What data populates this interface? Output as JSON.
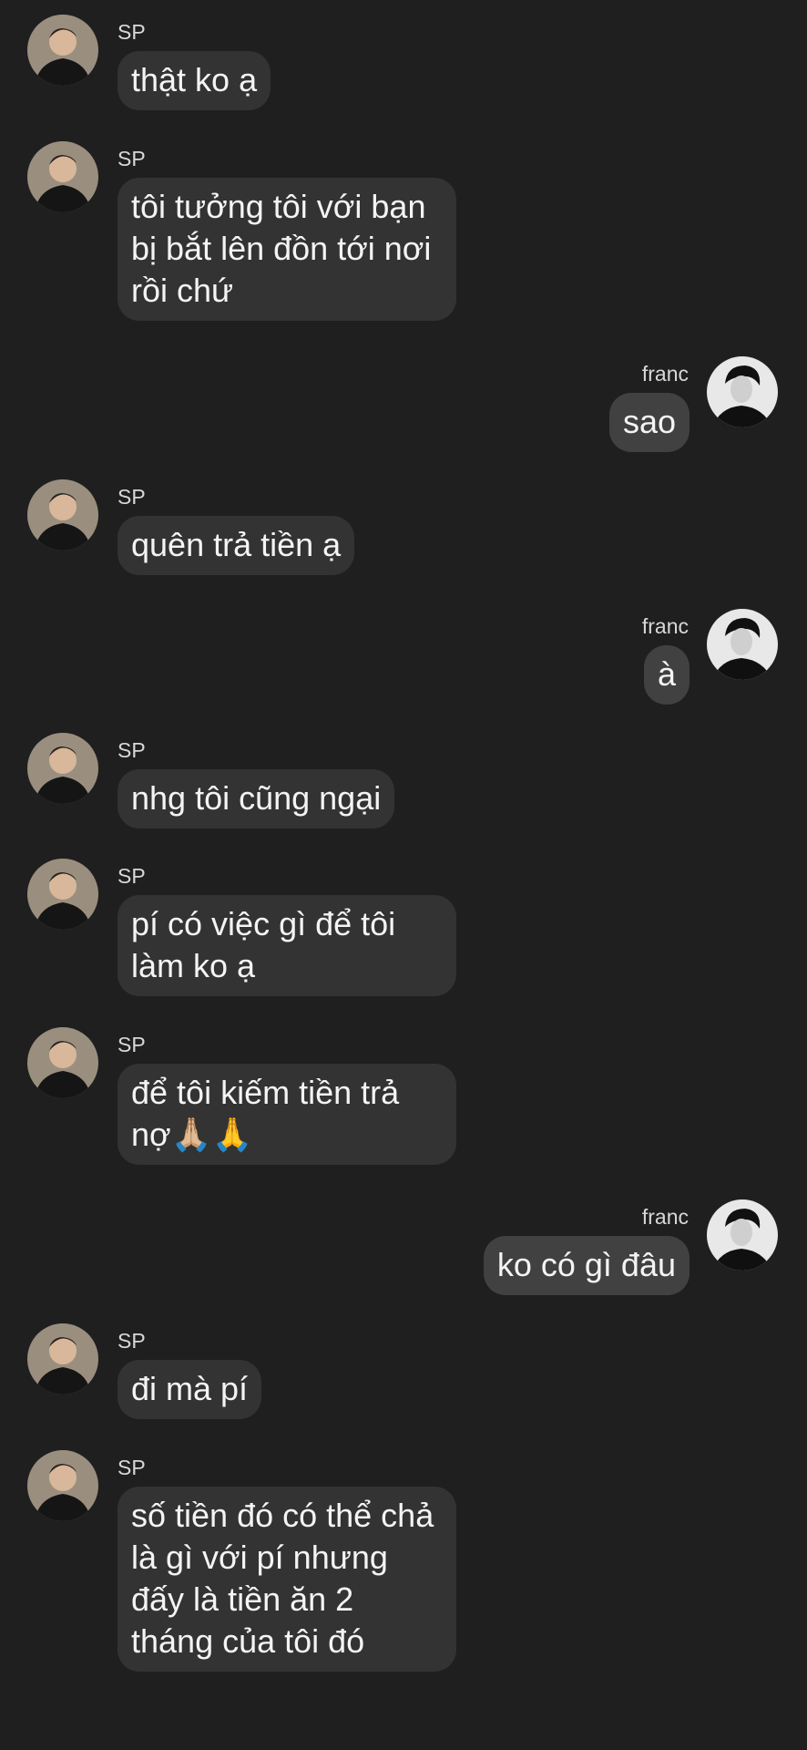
{
  "theme": {
    "background": "#1f1f1f",
    "incoming_bubble": "#333333",
    "outgoing_bubble": "#414141",
    "text": "#f4f4f4"
  },
  "contacts": {
    "them": "SP",
    "me": "franc"
  },
  "messages": [
    {
      "from": "them",
      "sender": "SP",
      "text": "thật ko ạ"
    },
    {
      "from": "them",
      "sender": "SP",
      "text": "tôi tưởng tôi với bạn bị bắt lên đồn tới nơi rồi chứ"
    },
    {
      "from": "me",
      "sender": "franc",
      "text": "sao"
    },
    {
      "from": "them",
      "sender": "SP",
      "text": "quên trả tiền ạ"
    },
    {
      "from": "me",
      "sender": "franc",
      "text": "à"
    },
    {
      "from": "them",
      "sender": "SP",
      "text": "nhg tôi cũng ngại"
    },
    {
      "from": "them",
      "sender": "SP",
      "text": "pí có việc gì để tôi làm ko ạ"
    },
    {
      "from": "them",
      "sender": "SP",
      "text": "để tôi kiếm tiền trả nợ🙏🏼🙏"
    },
    {
      "from": "me",
      "sender": "franc",
      "text": "ko có gì đâu"
    },
    {
      "from": "them",
      "sender": "SP",
      "text": "đi mà pí"
    },
    {
      "from": "them",
      "sender": "SP",
      "text": "số tiền đó có thể chả là gì với pí nhưng đấy là tiền ăn 2 tháng của tôi đó"
    }
  ]
}
